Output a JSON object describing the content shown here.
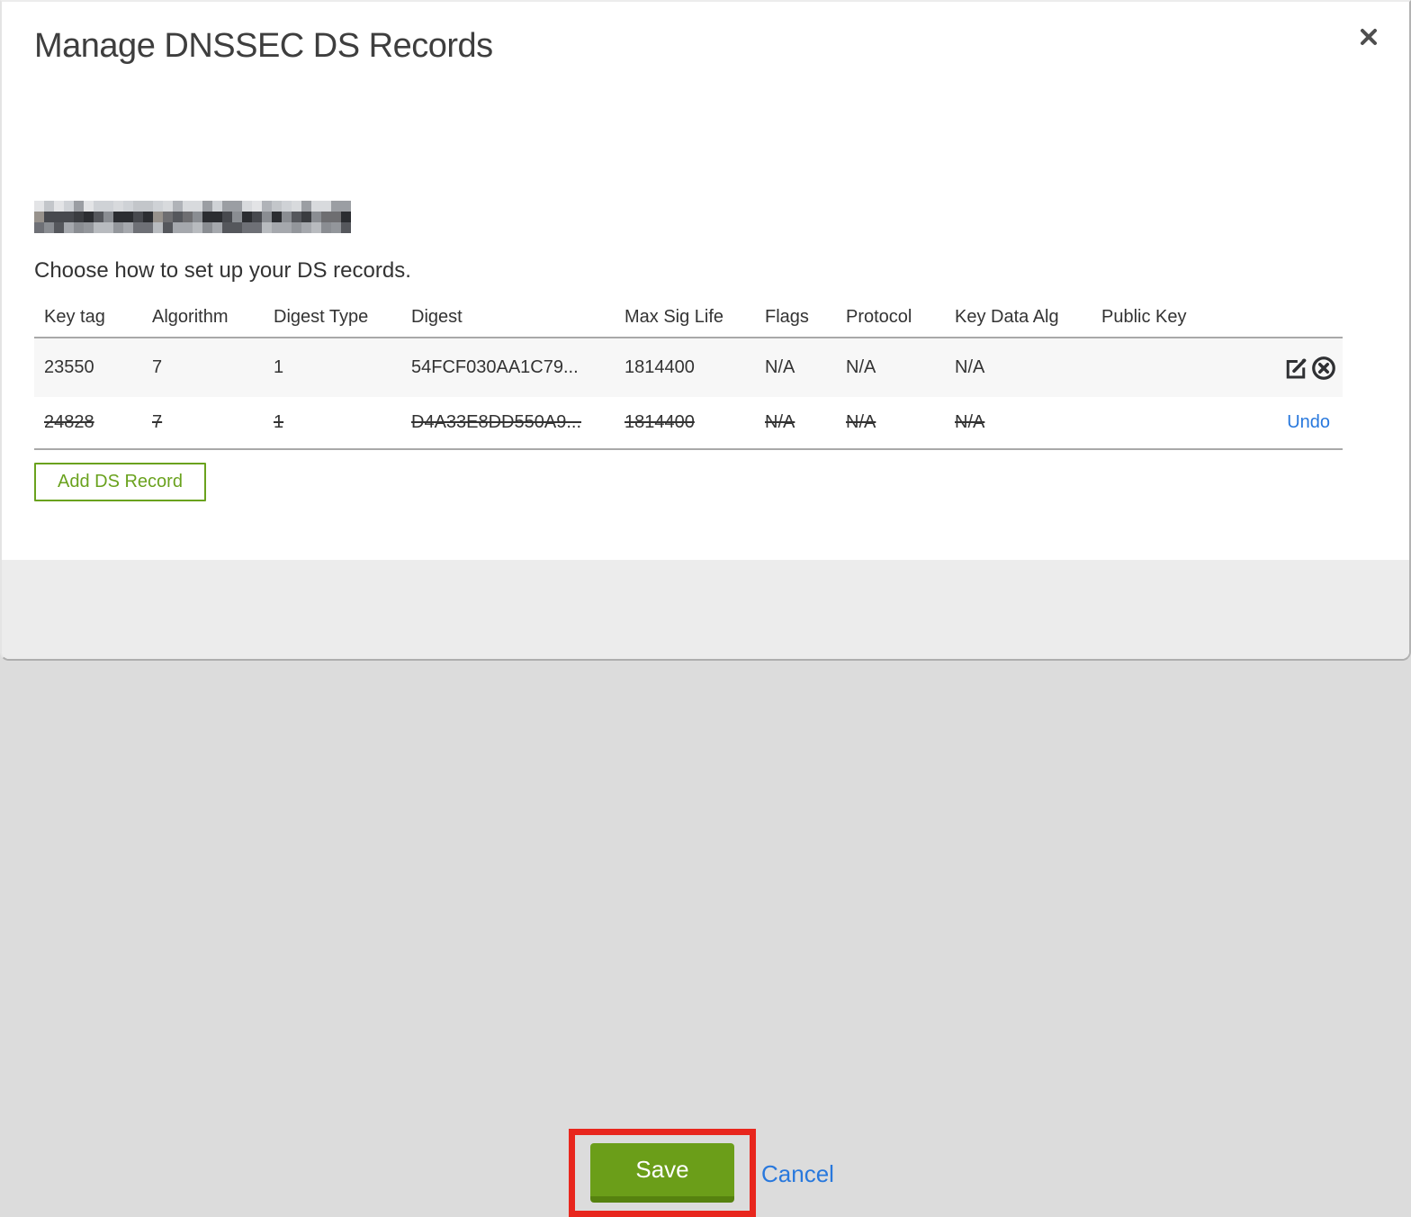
{
  "modal": {
    "title": "Manage DNSSEC DS Records"
  },
  "domain": {
    "redacted": true,
    "note": "domain name pixelated/blurred"
  },
  "instruction": "Choose how to set up your DS records.",
  "table": {
    "headers": [
      "Key tag",
      "Algorithm",
      "Digest Type",
      "Digest",
      "Max Sig Life",
      "Flags",
      "Protocol",
      "Key Data Alg",
      "Public Key"
    ],
    "rows": [
      {
        "key_tag": "23550",
        "algorithm": "7",
        "digest_type": "1",
        "digest": "54FCF030AA1C79...",
        "max_sig_life": "1814400",
        "flags": "N/A",
        "protocol": "N/A",
        "key_data_alg": "N/A",
        "public_key": "",
        "state": "active",
        "actions": [
          "edit",
          "delete"
        ]
      },
      {
        "key_tag": "24828",
        "algorithm": "7",
        "digest_type": "1",
        "digest": "D4A33E8DD550A9...",
        "max_sig_life": "1814400",
        "flags": "N/A",
        "protocol": "N/A",
        "key_data_alg": "N/A",
        "public_key": "",
        "state": "deleted",
        "actions": [
          "undo"
        ],
        "undo_label": "Undo"
      }
    ]
  },
  "buttons": {
    "add_ds_record": "Add DS Record",
    "save": "Save",
    "cancel": "Cancel"
  },
  "annotation": {
    "type": "highlight-rectangle",
    "target": "save-button",
    "color": "#e8261d"
  },
  "colors": {
    "accent_green": "#6b9e19",
    "outline_green": "#6aa21e",
    "link_blue": "#2878dd",
    "annotation_red": "#e8261d",
    "footer_bg": "#ececec",
    "row_alt_bg": "#f7f7f7",
    "border_gray": "#a9a9a9",
    "text": "#333333"
  }
}
